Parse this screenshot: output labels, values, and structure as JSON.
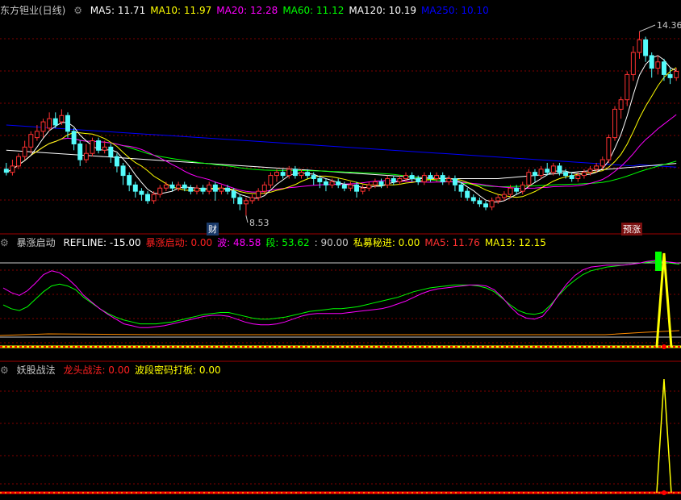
{
  "main_panel": {
    "title": "东方钽业(日线)",
    "ma_labels": [
      {
        "text": "MA5: 11.71",
        "color": "#ffffff"
      },
      {
        "text": "MA10: 11.97",
        "color": "#ffff00"
      },
      {
        "text": "MA20: 12.28",
        "color": "#ff00ff"
      },
      {
        "text": "MA60: 11.12",
        "color": "#00ff00"
      },
      {
        "text": "MA120: 10.19",
        "color": "#ffffff"
      },
      {
        "text": "MA250: 10.10",
        "color": "#0000ff"
      }
    ],
    "high_label": "14.36",
    "low_label": "8.53",
    "marker_cai": "财",
    "marker_yuzhang": "预涨"
  },
  "panel2": {
    "title": "暴涨启动",
    "items": [
      {
        "text": "REFLINE: -15.00",
        "color": "#ffffff"
      },
      {
        "text": "暴涨启动: 0.00",
        "color": "#ff2020"
      },
      {
        "text": "波: 48.58",
        "color": "#ff00ff"
      },
      {
        "text": "段: 53.62",
        "color": "#00ff00"
      },
      {
        "text": ": 90.00",
        "color": "#c8c8c8"
      },
      {
        "text": "私募秘进: 0.00",
        "color": "#ffff00"
      },
      {
        "text": "MA5: 11.76",
        "color": "#ff3030"
      },
      {
        "text": "MA13: 12.15",
        "color": "#ffff00"
      }
    ]
  },
  "panel3": {
    "title": "妖股战法",
    "items": [
      {
        "text": "龙头战法: 0.00",
        "color": "#ff2020"
      },
      {
        "text": "波段密码打板: 0.00",
        "color": "#ffff00"
      }
    ]
  },
  "colors": {
    "up": "#ff3232",
    "down": "#54fcfc",
    "ma5": "#ffffff",
    "ma10": "#ffff00",
    "ma20": "#ff00ff",
    "ma60": "#00ff00",
    "ma120": "#ffffff",
    "ma250": "#0000ff",
    "grid": "#800000"
  },
  "chart_data": [
    {
      "type": "candlestick",
      "title": "东方钽业(日线)",
      "ylim": [
        8.0,
        14.8
      ],
      "candles": [
        [
          10.0,
          9.9,
          10.2,
          9.8
        ],
        [
          9.9,
          10.1,
          10.3,
          9.8
        ],
        [
          10.1,
          10.4,
          10.5,
          10.0
        ],
        [
          10.4,
          10.7,
          10.9,
          10.3
        ],
        [
          10.7,
          11.1,
          11.2,
          10.5
        ],
        [
          11.0,
          11.2,
          11.4,
          10.9
        ],
        [
          11.2,
          11.5,
          11.6,
          11.0
        ],
        [
          11.3,
          11.6,
          11.8,
          11.2
        ],
        [
          11.6,
          11.4,
          11.8,
          11.3
        ],
        [
          11.5,
          11.7,
          11.9,
          11.4
        ],
        [
          11.7,
          11.2,
          11.8,
          11.0
        ],
        [
          11.2,
          10.8,
          11.3,
          10.6
        ],
        [
          10.8,
          10.3,
          10.9,
          10.1
        ],
        [
          10.3,
          10.5,
          10.8,
          10.2
        ],
        [
          10.5,
          10.9,
          11.0,
          10.4
        ],
        [
          10.9,
          10.6,
          11.0,
          10.5
        ],
        [
          10.6,
          10.7,
          10.9,
          10.5
        ],
        [
          10.7,
          10.4,
          10.8,
          10.2
        ],
        [
          10.4,
          10.1,
          10.5,
          9.9
        ],
        [
          10.1,
          9.8,
          10.2,
          9.5
        ],
        [
          9.8,
          9.5,
          9.9,
          9.3
        ],
        [
          9.5,
          9.3,
          9.6,
          9.1
        ],
        [
          9.3,
          9.2,
          9.4,
          9.0
        ],
        [
          9.2,
          9.0,
          9.3,
          8.9
        ],
        [
          9.0,
          9.2,
          9.3,
          8.9
        ],
        [
          9.2,
          9.4,
          9.5,
          9.1
        ],
        [
          9.4,
          9.5,
          9.6,
          9.3
        ],
        [
          9.5,
          9.4,
          9.6,
          9.3
        ],
        [
          9.4,
          9.5,
          9.6,
          9.3
        ],
        [
          9.5,
          9.4,
          9.6,
          9.3
        ],
        [
          9.4,
          9.3,
          9.5,
          9.2
        ],
        [
          9.3,
          9.4,
          9.5,
          9.2
        ],
        [
          9.4,
          9.3,
          9.5,
          9.2
        ],
        [
          9.3,
          9.5,
          9.6,
          9.2
        ],
        [
          9.5,
          9.3,
          9.6,
          9.0
        ],
        [
          9.3,
          9.4,
          9.5,
          9.2
        ],
        [
          9.4,
          9.3,
          9.5,
          9.2
        ],
        [
          9.3,
          9.1,
          9.4,
          8.9
        ],
        [
          9.1,
          8.9,
          9.2,
          8.7
        ],
        [
          8.9,
          9.0,
          9.1,
          8.53
        ],
        [
          9.0,
          9.1,
          9.2,
          8.9
        ],
        [
          9.1,
          9.3,
          9.4,
          9.0
        ],
        [
          9.3,
          9.5,
          9.6,
          9.2
        ],
        [
          9.5,
          9.8,
          9.9,
          9.4
        ],
        [
          9.8,
          9.9,
          10.0,
          9.6
        ],
        [
          9.9,
          9.8,
          10.0,
          9.7
        ],
        [
          9.8,
          10.0,
          10.1,
          9.7
        ],
        [
          10.0,
          9.8,
          10.1,
          9.7
        ],
        [
          9.8,
          9.9,
          10.0,
          9.7
        ],
        [
          9.9,
          9.8,
          10.0,
          9.7
        ],
        [
          9.8,
          9.7,
          9.9,
          9.5
        ],
        [
          9.7,
          9.6,
          9.8,
          9.4
        ],
        [
          9.6,
          9.5,
          9.7,
          9.3
        ],
        [
          9.5,
          9.6,
          9.7,
          9.4
        ],
        [
          9.6,
          9.5,
          9.7,
          9.4
        ],
        [
          9.5,
          9.4,
          9.6,
          9.3
        ],
        [
          9.4,
          9.5,
          9.6,
          9.3
        ],
        [
          9.5,
          9.3,
          9.6,
          9.1
        ],
        [
          9.3,
          9.4,
          9.5,
          9.2
        ],
        [
          9.4,
          9.5,
          9.6,
          9.3
        ],
        [
          9.5,
          9.6,
          9.7,
          9.4
        ],
        [
          9.6,
          9.5,
          9.7,
          9.4
        ],
        [
          9.5,
          9.7,
          9.8,
          9.4
        ],
        [
          9.7,
          9.6,
          9.8,
          9.5
        ],
        [
          9.6,
          9.7,
          9.8,
          9.5
        ],
        [
          9.7,
          9.8,
          9.9,
          9.6
        ],
        [
          9.8,
          9.7,
          9.9,
          9.6
        ],
        [
          9.7,
          9.6,
          9.8,
          9.5
        ],
        [
          9.6,
          9.8,
          9.9,
          9.5
        ],
        [
          9.8,
          9.7,
          9.9,
          9.6
        ],
        [
          9.7,
          9.8,
          9.9,
          9.6
        ],
        [
          9.8,
          9.6,
          9.9,
          9.5
        ],
        [
          9.6,
          9.7,
          9.8,
          9.5
        ],
        [
          9.7,
          9.5,
          9.8,
          9.3
        ],
        [
          9.5,
          9.3,
          9.6,
          9.1
        ],
        [
          9.3,
          9.1,
          9.4,
          9.0
        ],
        [
          9.1,
          9.0,
          9.2,
          8.9
        ],
        [
          9.0,
          8.9,
          9.1,
          8.8
        ],
        [
          8.9,
          8.8,
          9.0,
          8.7
        ],
        [
          8.8,
          9.0,
          9.1,
          8.7
        ],
        [
          9.0,
          9.1,
          9.2,
          8.9
        ],
        [
          9.1,
          9.2,
          9.3,
          9.0
        ],
        [
          9.2,
          9.4,
          9.5,
          9.1
        ],
        [
          9.4,
          9.3,
          9.5,
          9.2
        ],
        [
          9.3,
          9.5,
          9.6,
          9.2
        ],
        [
          9.5,
          9.9,
          10.0,
          9.4
        ],
        [
          9.9,
          9.8,
          10.0,
          9.6
        ],
        [
          9.8,
          10.0,
          10.1,
          9.7
        ],
        [
          10.0,
          9.9,
          10.2,
          9.8
        ],
        [
          9.9,
          10.1,
          10.2,
          9.8
        ],
        [
          10.1,
          9.9,
          10.2,
          9.8
        ],
        [
          9.9,
          9.8,
          10.0,
          9.7
        ],
        [
          9.8,
          9.7,
          9.9,
          9.6
        ],
        [
          9.7,
          9.8,
          9.9,
          9.6
        ],
        [
          9.8,
          9.9,
          10.0,
          9.7
        ],
        [
          9.9,
          10.0,
          10.1,
          9.8
        ],
        [
          10.0,
          10.1,
          10.2,
          9.9
        ],
        [
          10.1,
          10.3,
          10.4,
          10.0
        ],
        [
          10.3,
          11.0,
          11.1,
          10.2
        ],
        [
          11.0,
          11.9,
          12.0,
          10.9
        ],
        [
          11.9,
          12.2,
          12.3,
          11.6
        ],
        [
          12.2,
          13.0,
          13.1,
          12.0
        ],
        [
          13.0,
          13.7,
          13.9,
          12.8
        ],
        [
          13.7,
          14.1,
          14.36,
          13.5
        ],
        [
          14.1,
          13.6,
          14.2,
          13.4
        ],
        [
          13.6,
          13.2,
          13.7,
          12.9
        ],
        [
          13.2,
          13.4,
          13.6,
          13.0
        ],
        [
          13.4,
          13.0,
          13.5,
          12.8
        ],
        [
          13.0,
          12.9,
          13.2,
          12.7
        ],
        [
          12.9,
          13.1,
          13.2,
          12.8
        ]
      ],
      "series": [
        {
          "name": "MA5",
          "values": []
        },
        {
          "name": "MA10",
          "values": []
        },
        {
          "name": "MA20",
          "values": []
        },
        {
          "name": "MA60",
          "values": []
        },
        {
          "name": "MA120",
          "values": []
        },
        {
          "name": "MA250",
          "values": []
        }
      ]
    },
    {
      "type": "line",
      "title": "暴涨启动",
      "ylim": [
        -15,
        100
      ],
      "series": [
        {
          "name": "波",
          "values": [
            60,
            55,
            52,
            57,
            65,
            74,
            78,
            76,
            70,
            62,
            52,
            45,
            38,
            32,
            27,
            22,
            20,
            18,
            18,
            19,
            20,
            22,
            24,
            26,
            28,
            30,
            31,
            31,
            30,
            27,
            24,
            22,
            21,
            21,
            22,
            24,
            27,
            30,
            32,
            33,
            33,
            33,
            33,
            34,
            35,
            36,
            37,
            38,
            40,
            43,
            46,
            50,
            54,
            57,
            59,
            60,
            61,
            62,
            63,
            63,
            62,
            58,
            50,
            40,
            32,
            28,
            27,
            30,
            40,
            53,
            64,
            73,
            79,
            82,
            83,
            84,
            84,
            84,
            85,
            86,
            88,
            89,
            88,
            87,
            86
          ]
        },
        {
          "name": "段",
          "values": [
            42,
            38,
            36,
            40,
            48,
            56,
            62,
            64,
            62,
            58,
            50,
            44,
            38,
            33,
            29,
            26,
            24,
            22,
            22,
            22,
            23,
            24,
            26,
            28,
            30,
            32,
            33,
            34,
            34,
            32,
            30,
            28,
            27,
            27,
            28,
            29,
            31,
            33,
            35,
            36,
            37,
            38,
            38,
            39,
            40,
            42,
            44,
            46,
            48,
            50,
            53,
            56,
            58,
            60,
            61,
            62,
            63,
            63,
            63,
            62,
            60,
            56,
            49,
            42,
            36,
            33,
            32,
            34,
            42,
            52,
            61,
            68,
            74,
            78,
            80,
            82,
            83,
            84,
            85,
            86,
            87,
            88,
            87,
            86,
            85
          ]
        },
        {
          "name": "REFLINE",
          "values": [
            -15,
            -15
          ]
        },
        {
          "name": "90",
          "values": [
            90,
            90
          ]
        },
        {
          "name": "暴涨启动",
          "values": [
            0,
            0
          ]
        },
        {
          "name": "私募秘进",
          "spike_index": 107,
          "spike_value": 100
        }
      ]
    },
    {
      "type": "line",
      "title": "妖股战法",
      "series": [
        {
          "name": "龙头战法",
          "values": [
            0,
            0
          ]
        },
        {
          "name": "波段密码打板",
          "spike_index": 107,
          "spike_value": 1
        }
      ]
    }
  ]
}
